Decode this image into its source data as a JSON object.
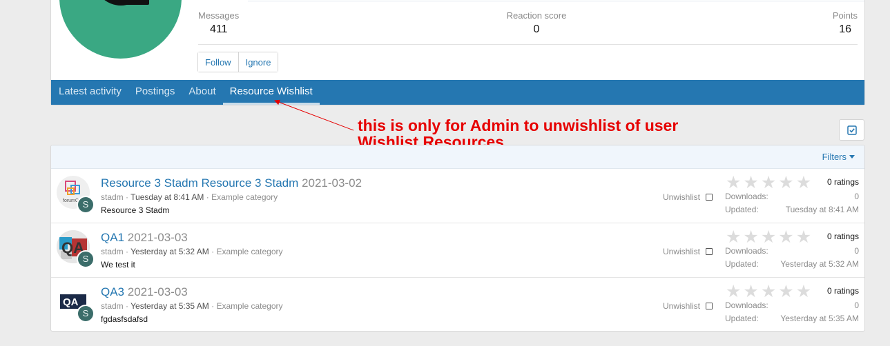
{
  "profile": {
    "stats": [
      {
        "label": "Messages",
        "value": "411"
      },
      {
        "label": "Reaction score",
        "value": "0"
      },
      {
        "label": "Points",
        "value": "16"
      }
    ],
    "buttons": {
      "follow": "Follow",
      "ignore": "Ignore"
    },
    "avatar_color": "#3aa883"
  },
  "tabs": [
    {
      "label": "Latest activity"
    },
    {
      "label": "Postings"
    },
    {
      "label": "About"
    },
    {
      "label": "Resource Wishlist"
    }
  ],
  "annotation": {
    "line1": "this is only for Admin to unwishlist of user",
    "line2": "Wishlist Resources",
    "color": "#e60000"
  },
  "list": {
    "filters_label": "Filters",
    "unwishlist_label": "Unwishlist",
    "downloads_label": "Downloads:",
    "updated_label": "Updated:",
    "items": [
      {
        "title": "Resource 3 Stadm Resource 3 Stadm",
        "version": "2021-03-02",
        "author": "stadm",
        "time": "Tuesday at 8:41 AM",
        "category": "Example category",
        "description": "Resource 3 Stadm",
        "ratings": "0 ratings",
        "downloads": "0",
        "updated": "Tuesday at 8:41 AM",
        "avatar_letter": "S",
        "thumb_icon": "forum-logo-icon",
        "thumb_text": "forumC"
      },
      {
        "title": "QA1",
        "version": "2021-03-03",
        "author": "stadm",
        "time": "Yesterday at 5:32 AM",
        "category": "Example category",
        "description": "We test it",
        "ratings": "0 ratings",
        "downloads": "0",
        "updated": "Yesterday at 5:32 AM",
        "avatar_letter": "S",
        "thumb_icon": "qa-puzzle-icon"
      },
      {
        "title": "QA3",
        "version": "2021-03-03",
        "author": "stadm",
        "time": "Yesterday at 5:35 AM",
        "category": "Example category",
        "description": "fgdasfsdafsd",
        "ratings": "0 ratings",
        "downloads": "0",
        "updated": "Yesterday at 5:35 AM",
        "avatar_letter": "S",
        "thumb_icon": "qa-logo-icon",
        "thumb_text": "QA"
      }
    ]
  },
  "colors": {
    "accent": "#2577b1",
    "mini_avatar": "#3b6d6a"
  }
}
